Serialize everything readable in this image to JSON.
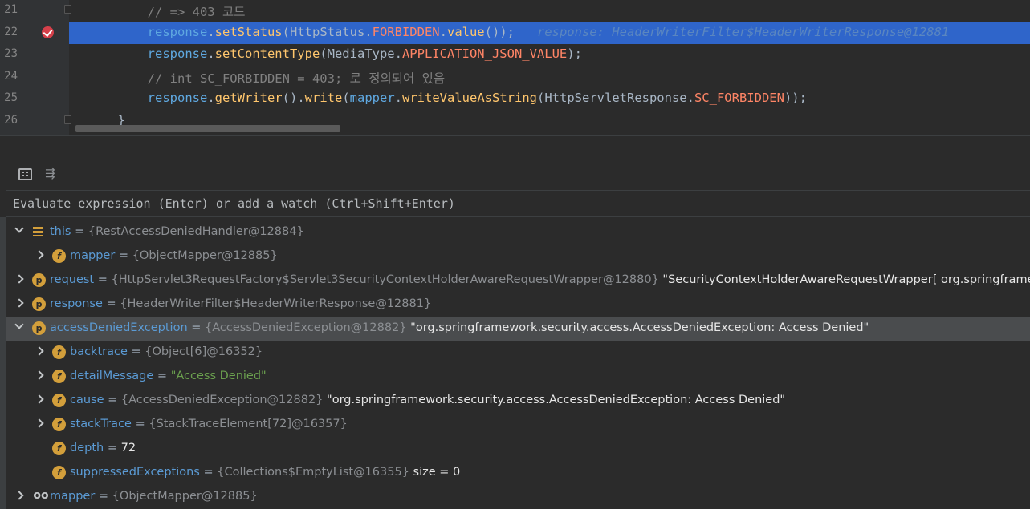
{
  "editor": {
    "lines": [
      {
        "num": "21",
        "parts": [
          {
            "t": "        // => 403 코드",
            "c": "c-cmt"
          }
        ]
      },
      {
        "num": "22",
        "highlight": true,
        "breakpoint": true,
        "parts": [
          {
            "t": "        ",
            "c": ""
          },
          {
            "t": "response",
            "c": "c-var"
          },
          {
            "t": ".",
            "c": ""
          },
          {
            "t": "setStatus",
            "c": "c-mth"
          },
          {
            "t": "(HttpStatus.",
            "c": ""
          },
          {
            "t": "FORBIDDEN",
            "c": "c-konst"
          },
          {
            "t": ".",
            "c": ""
          },
          {
            "t": "value",
            "c": "c-mth"
          },
          {
            "t": "());",
            "c": ""
          },
          {
            "t": "   response: HeaderWriterFilter$HeaderWriterResponse@12881",
            "c": "c-inline"
          }
        ]
      },
      {
        "num": "23",
        "parts": [
          {
            "t": "        ",
            "c": ""
          },
          {
            "t": "response",
            "c": "c-var"
          },
          {
            "t": ".",
            "c": ""
          },
          {
            "t": "setContentType",
            "c": "c-mth"
          },
          {
            "t": "(MediaType.",
            "c": ""
          },
          {
            "t": "APPLICATION_JSON_VALUE",
            "c": "c-konst"
          },
          {
            "t": ");",
            "c": ""
          }
        ]
      },
      {
        "num": "24",
        "parts": [
          {
            "t": "        // int SC_FORBIDDEN = 403; 로 정의되어 있음",
            "c": "c-cmt"
          }
        ]
      },
      {
        "num": "25",
        "parts": [
          {
            "t": "        ",
            "c": ""
          },
          {
            "t": "response",
            "c": "c-var"
          },
          {
            "t": ".",
            "c": ""
          },
          {
            "t": "getWriter",
            "c": "c-mth"
          },
          {
            "t": "().",
            "c": ""
          },
          {
            "t": "write",
            "c": "c-mth"
          },
          {
            "t": "(",
            "c": ""
          },
          {
            "t": "mapper",
            "c": "c-var"
          },
          {
            "t": ".",
            "c": ""
          },
          {
            "t": "writeValueAsString",
            "c": "c-mth"
          },
          {
            "t": "(HttpServletResponse.",
            "c": ""
          },
          {
            "t": "SC_FORBIDDEN",
            "c": "c-konst"
          },
          {
            "t": "));",
            "c": ""
          }
        ]
      },
      {
        "num": "26",
        "parts": [
          {
            "t": "    }",
            "c": ""
          }
        ]
      }
    ]
  },
  "debugger": {
    "toolbar": {
      "calculator_icon": "calculator-icon",
      "watch_icon": "watches-toggle-icon"
    },
    "evaluate_placeholder": "Evaluate expression (Enter) or add a watch (Ctrl+Shift+Enter)",
    "variables": [
      {
        "depth": 0,
        "arrow": "exp",
        "icon": "lines",
        "name": "this",
        "eq": " = ",
        "type": "{RestAccessDeniedHandler@12884}",
        "value": ""
      },
      {
        "depth": 1,
        "arrow": "col",
        "icon": "f",
        "name": "mapper",
        "eq": " = ",
        "type": "{ObjectMapper@12885}",
        "value": ""
      },
      {
        "depth": 0,
        "arrow": "col",
        "icon": "p",
        "name": "request",
        "eq": " = ",
        "type": "{HttpServlet3RequestFactory$Servlet3SecurityContextHolderAwareRequestWrapper@12880}",
        "value": " \"SecurityContextHolderAwareRequestWrapper[ org.springframework.security.w"
      },
      {
        "depth": 0,
        "arrow": "col",
        "icon": "p",
        "name": "response",
        "eq": " = ",
        "type": "{HeaderWriterFilter$HeaderWriterResponse@12881}",
        "value": ""
      },
      {
        "depth": 0,
        "arrow": "exp",
        "icon": "p",
        "name": "accessDeniedException",
        "eq": " = ",
        "type": "{AccessDeniedException@12882}",
        "value": " \"org.springframework.security.access.AccessDeniedException: Access Denied\"",
        "selected": true
      },
      {
        "depth": 1,
        "arrow": "col",
        "icon": "f",
        "name": "backtrace",
        "eq": " = ",
        "type": "{Object[6]@16352}",
        "value": ""
      },
      {
        "depth": 1,
        "arrow": "col",
        "icon": "f",
        "name": "detailMessage",
        "eq": " = ",
        "type": "",
        "str": "\"Access Denied\"",
        "value": ""
      },
      {
        "depth": 1,
        "arrow": "col",
        "icon": "f",
        "name": "cause",
        "eq": " = ",
        "type": "{AccessDeniedException@12882}",
        "value": " \"org.springframework.security.access.AccessDeniedException: Access Denied\""
      },
      {
        "depth": 1,
        "arrow": "col",
        "icon": "f",
        "name": "stackTrace",
        "eq": " = ",
        "type": "{StackTraceElement[72]@16357}",
        "value": ""
      },
      {
        "depth": 1,
        "arrow": "",
        "icon": "f",
        "name": "depth",
        "eq": " = ",
        "type": "",
        "value": "72"
      },
      {
        "depth": 1,
        "arrow": "",
        "icon": "f",
        "name": "suppressedExceptions",
        "eq": " = ",
        "type": "{Collections$EmptyList@16355}",
        "value": "  size = 0"
      },
      {
        "depth": 0,
        "arrow": "col",
        "icon": "glasses",
        "name": "mapper",
        "eq": " = ",
        "type": "{ObjectMapper@12885}",
        "value": ""
      }
    ]
  }
}
